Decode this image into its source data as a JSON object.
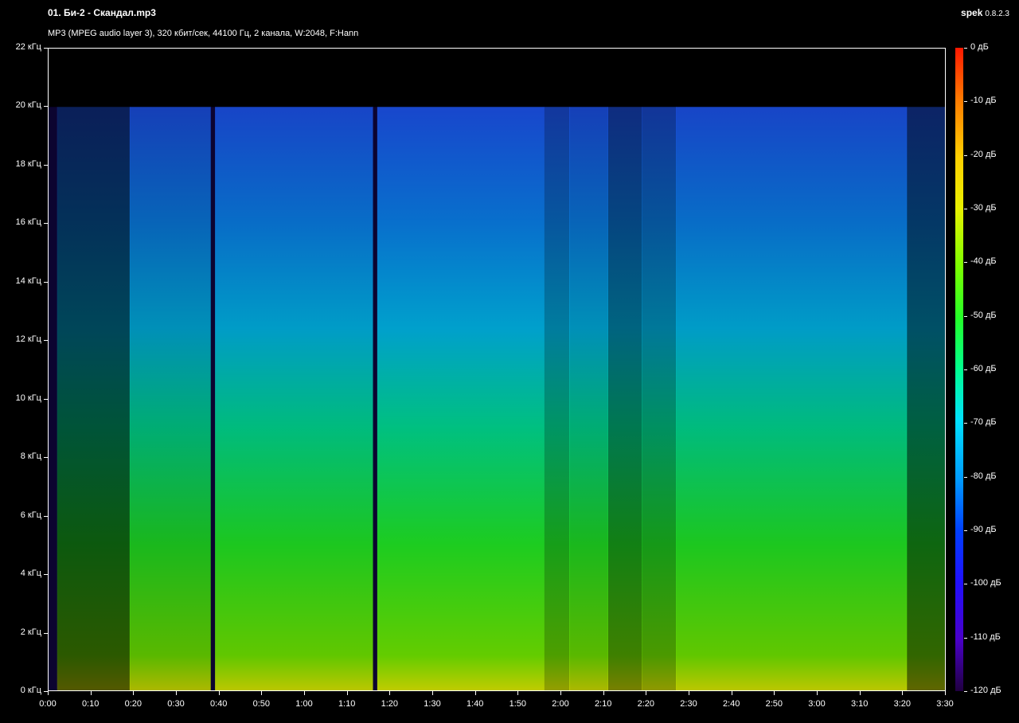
{
  "header": {
    "title": "01. Би-2 - Скандал.mp3",
    "info": "MP3 (MPEG audio layer 3), 320 кбит/сек, 44100 Гц, 2 канала, W:2048, F:Hann",
    "app_name": "spek",
    "app_version": "0.8.2.3"
  },
  "chart_data": {
    "type": "heatmap",
    "y_ticks": [
      "0 кГц",
      "2 кГц",
      "4 кГц",
      "6 кГц",
      "8 кГц",
      "10 кГц",
      "12 кГц",
      "14 кГц",
      "16 кГц",
      "18 кГц",
      "20 кГц",
      "22 кГц"
    ],
    "x_ticks": [
      "0:00",
      "0:10",
      "0:20",
      "0:30",
      "0:40",
      "0:50",
      "1:00",
      "1:10",
      "1:20",
      "1:30",
      "1:40",
      "1:50",
      "2:00",
      "2:10",
      "2:20",
      "2:30",
      "2:40",
      "2:50",
      "3:00",
      "3:10",
      "3:20",
      "3:30"
    ],
    "colorbar_ticks": [
      "0 дБ",
      "-10 дБ",
      "-20 дБ",
      "-30 дБ",
      "-40 дБ",
      "-50 дБ",
      "-60 дБ",
      "-70 дБ",
      "-80 дБ",
      "-90 дБ",
      "-100 дБ",
      "-110 дБ",
      "-120 дБ"
    ],
    "ylim_khz": [
      0,
      22
    ],
    "xlim_sec": [
      0,
      210
    ],
    "clim_db": [
      -120,
      0
    ],
    "cutoff_khz": 20,
    "colormap": [
      "#ff1800",
      "#ffd000",
      "#7cff00",
      "#00ff90",
      "#00e0ff",
      "#009cff",
      "#0040ff",
      "#4a00c8",
      "#200040"
    ],
    "segments": [
      {
        "start": 0,
        "end": 2,
        "level": 0.0
      },
      {
        "start": 2,
        "end": 19,
        "level": 0.35
      },
      {
        "start": 19,
        "end": 38,
        "level": 0.72
      },
      {
        "start": 38,
        "end": 39,
        "level": 0.05
      },
      {
        "start": 39,
        "end": 76,
        "level": 0.78
      },
      {
        "start": 76,
        "end": 77,
        "level": 0.05
      },
      {
        "start": 77,
        "end": 116,
        "level": 0.8
      },
      {
        "start": 116,
        "end": 122,
        "level": 0.62
      },
      {
        "start": 122,
        "end": 131,
        "level": 0.72
      },
      {
        "start": 131,
        "end": 139,
        "level": 0.5
      },
      {
        "start": 139,
        "end": 147,
        "level": 0.6
      },
      {
        "start": 147,
        "end": 201,
        "level": 0.78
      },
      {
        "start": 201,
        "end": 210,
        "level": 0.4
      }
    ]
  }
}
